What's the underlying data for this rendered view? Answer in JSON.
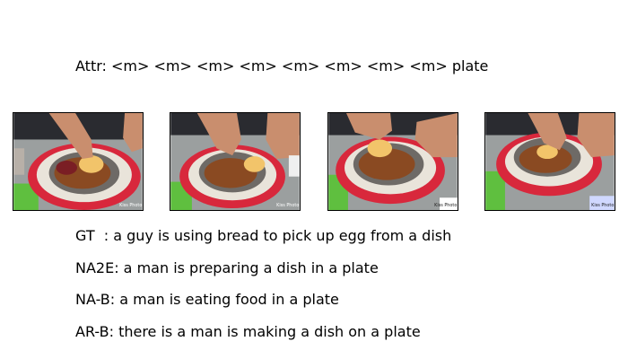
{
  "attr_line": "Attr: <m> <m> <m> <m> <m> <m> <m> <m> plate",
  "frames": [
    {
      "watermark": "Kiss Photo"
    },
    {
      "watermark": "Kiss Photo"
    },
    {
      "watermark": "Kiss Photo"
    },
    {
      "watermark": "Kiss Photo"
    }
  ],
  "captions": {
    "gt": "GT  : a guy is using bread to pick up egg from a dish",
    "na2e": "NA2E: a man is preparing a dish in a plate",
    "nab": "NA-B: a man is eating food in a plate",
    "arb": "AR-B: there is a man is making a dish on a plate"
  },
  "colors": {
    "plate_rim": "#d8283c",
    "food": "#8a4a22",
    "skin": "#c98e6e",
    "shirt": "#2a2b30"
  }
}
